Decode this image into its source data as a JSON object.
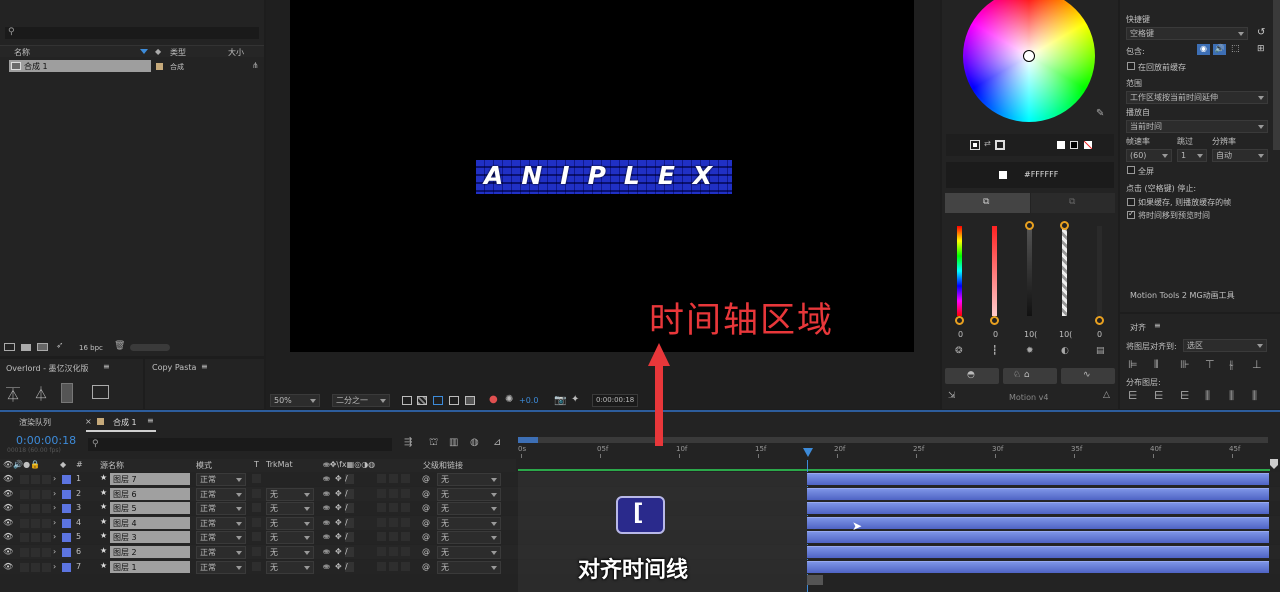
{
  "project": {
    "search_placeholder": "",
    "col_name": "名称",
    "col_type": "类型",
    "col_size": "大小",
    "item_name": "合成 1",
    "item_type": "合成",
    "bpc": "16 bpc"
  },
  "plugins": {
    "overlord_title": "Overlord - 墨亿汉化版",
    "copypasta_title": "Copy Pasta"
  },
  "viewer": {
    "logo_text": "ANIPLEX",
    "zoom": "50%",
    "resolution": "二分之一",
    "exposure": "+0.0",
    "timecode": "0:00:00:18"
  },
  "color": {
    "hex": "#FFFFFF",
    "values": [
      "0",
      "0",
      "10(",
      "10(",
      "0"
    ],
    "motion_title": "Motion v4",
    "colors": {
      "accent": "#4b63d0",
      "bar": "#6a80dc",
      "annotation_red": "#e8373a"
    }
  },
  "preview": {
    "shortcut_label": "快捷键",
    "shortcut_value": "空格键",
    "include_label": "包含:",
    "cache_before": "在回放前缓存",
    "range_label": "范围",
    "range_value": "工作区域按当前时间延伸",
    "play_from_label": "播放自",
    "play_from_value": "当前时间",
    "framerate_label": "帧速率",
    "skip_label": "跳过",
    "resolution_label": "分辨率",
    "framerate_value": "(60)",
    "skip_value": "1",
    "resolution_value": "自动",
    "fullscreen": "全屏",
    "on_stop_label": "点击 (空格键) 停止:",
    "if_cache": "如果缓存, 则播放缓存的帧",
    "move_time": "将时间移到预览时间",
    "motion_tools": "Motion Tools 2 MG动画工具"
  },
  "align": {
    "title": "对齐",
    "align_to_label": "将图层对齐到:",
    "align_to_value": "选区",
    "distribute_label": "分布图层:"
  },
  "timeline": {
    "tab_render": "渲染队列",
    "tab_comp": "合成 1",
    "current_time": "0:00:00:18",
    "frame_info": "00018 (60.00 fps)",
    "search_placeholder": "",
    "col_source": "源名称",
    "col_mode": "模式",
    "col_t": "T",
    "col_trkmat": "TrkMat",
    "col_parent": "父级和链接",
    "ruler": [
      "0s",
      "05f",
      "10f",
      "15f",
      "20f",
      "25f",
      "30f",
      "35f",
      "40f",
      "45f"
    ],
    "layers": [
      {
        "num": "1",
        "name": "图层 7",
        "mode": "正常",
        "trkmat": "",
        "parent": "无"
      },
      {
        "num": "2",
        "name": "图层 6",
        "mode": "正常",
        "trkmat": "无",
        "parent": "无"
      },
      {
        "num": "3",
        "name": "图层 5",
        "mode": "正常",
        "trkmat": "无",
        "parent": "无"
      },
      {
        "num": "4",
        "name": "图层 4",
        "mode": "正常",
        "trkmat": "无",
        "parent": "无"
      },
      {
        "num": "5",
        "name": "图层 3",
        "mode": "正常",
        "trkmat": "无",
        "parent": "无"
      },
      {
        "num": "6",
        "name": "图层 2",
        "mode": "正常",
        "trkmat": "无",
        "parent": "无"
      },
      {
        "num": "7",
        "name": "图层 1",
        "mode": "正常",
        "trkmat": "无",
        "parent": "无"
      }
    ]
  },
  "annotations": {
    "region_label": "时间轴区域",
    "key_label": "[",
    "caption": "对齐时间线"
  }
}
